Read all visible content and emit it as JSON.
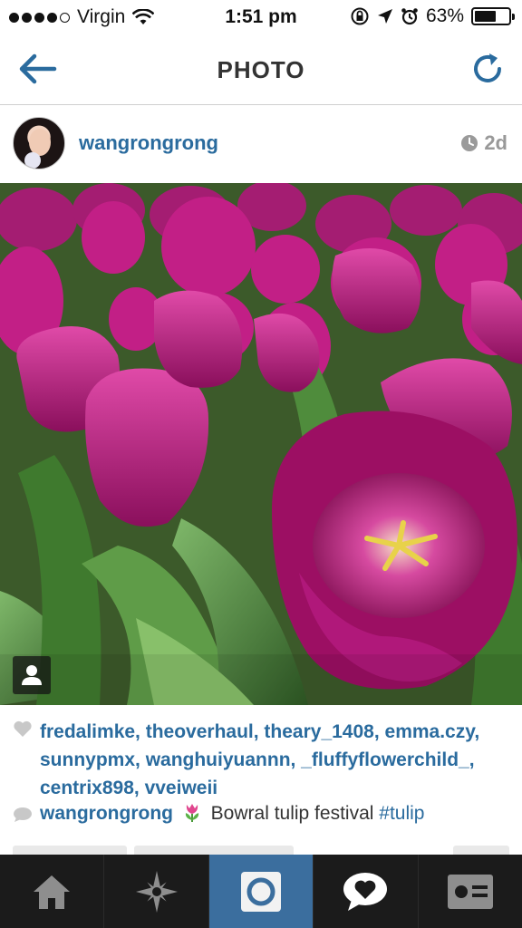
{
  "status_bar": {
    "carrier": "Virgin",
    "time": "1:51 pm",
    "battery_percent": "63%",
    "battery_level": 0.63,
    "signal_bars_filled": 4,
    "signal_bars_total": 5
  },
  "nav": {
    "title": "PHOTO",
    "back_icon": "back-arrow-icon",
    "refresh_icon": "refresh-icon",
    "accent_color": "#2a6b9e"
  },
  "post": {
    "username": "wangrongrong",
    "time_ago": "2d",
    "likes_text": "fredalimke, theoverhaul, theary_1408, emma.czy, sunnypmx, wanghuiyuannn, _fluffyflowerchild_, centrix898, vveiweii",
    "caption": {
      "user": "wangrongrong",
      "text": "Bowral tulip festival",
      "hashtag": "#tulip"
    }
  },
  "tab_bar": {
    "items": [
      {
        "icon": "home-icon"
      },
      {
        "icon": "explore-star-icon"
      },
      {
        "icon": "camera-icon",
        "active": true
      },
      {
        "icon": "activity-heart-bubble-icon"
      },
      {
        "icon": "profile-card-icon"
      }
    ],
    "active_color": "#3b6e9e"
  }
}
